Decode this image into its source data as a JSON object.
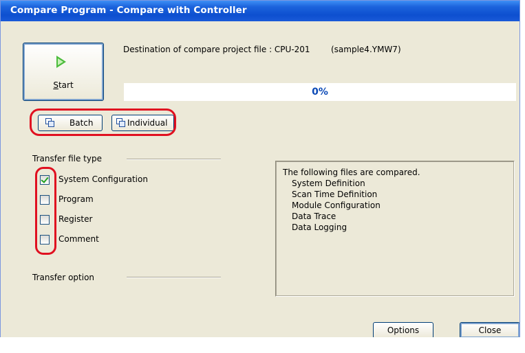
{
  "window": {
    "title": "Compare Program - Compare with Controller"
  },
  "start_button": {
    "label_ul": "S",
    "label_rest": "tart"
  },
  "destination": {
    "text": "Destination of compare project file : CPU-201",
    "file": "(sample4.YMW7)"
  },
  "progress": {
    "value": 0,
    "text": "0%"
  },
  "mode_buttons": {
    "batch": "Batch",
    "individual": "Individual"
  },
  "transfer_file_type": {
    "label": "Transfer file type",
    "items": [
      {
        "label": "System Configuration",
        "checked": true
      },
      {
        "label": "Program",
        "checked": false
      },
      {
        "label": "Register",
        "checked": false
      },
      {
        "label": "Comment",
        "checked": false
      }
    ]
  },
  "transfer_option": {
    "label": "Transfer option"
  },
  "info": {
    "heading": "The following files are compared.",
    "items": [
      "System Definition",
      "Scan Time Definition",
      "Module Configuration",
      "Data Trace",
      "Data Logging"
    ]
  },
  "buttons": {
    "options": "Options",
    "close": "Close"
  },
  "colors": {
    "highlight": "#e01020",
    "title_bar": "#0d4fd0",
    "progress_text": "#0b49b6"
  }
}
